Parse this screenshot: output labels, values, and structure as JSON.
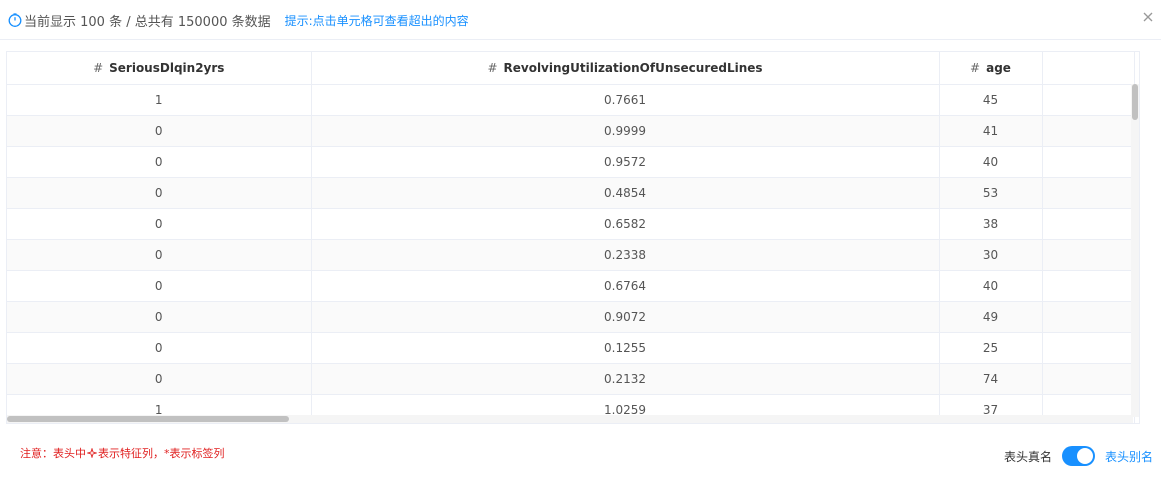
{
  "header": {
    "info": "当前显示 100 条 / 总共有 150000 条数据",
    "hint": "提示:点击单元格可查看超出的内容"
  },
  "table": {
    "columns": [
      {
        "hash": "#",
        "label": "SeriousDlqin2yrs"
      },
      {
        "hash": "#",
        "label": "RevolvingUtilizationOfUnsecuredLines"
      },
      {
        "hash": "#",
        "label": "age"
      }
    ],
    "rows": [
      [
        "1",
        "0.7661",
        "45"
      ],
      [
        "0",
        "0.9999",
        "41"
      ],
      [
        "0",
        "0.9572",
        "40"
      ],
      [
        "0",
        "0.4854",
        "53"
      ],
      [
        "0",
        "0.6582",
        "38"
      ],
      [
        "0",
        "0.2338",
        "30"
      ],
      [
        "0",
        "0.6764",
        "40"
      ],
      [
        "0",
        "0.9072",
        "49"
      ],
      [
        "0",
        "0.1255",
        "25"
      ],
      [
        "0",
        "0.2132",
        "74"
      ],
      [
        "1",
        "1.0259",
        "37"
      ]
    ]
  },
  "footer": {
    "note_prefix": "注意：表头中",
    "note_suffix": "表示特征列，*表示标签列",
    "switch_left": "表头真名",
    "switch_right": "表头别名",
    "switch_on": true
  },
  "colors": {
    "accent": "#1890ff",
    "warning": "#e02020"
  },
  "icons": [
    "clock-icon",
    "close-icon",
    "feature-icon"
  ]
}
